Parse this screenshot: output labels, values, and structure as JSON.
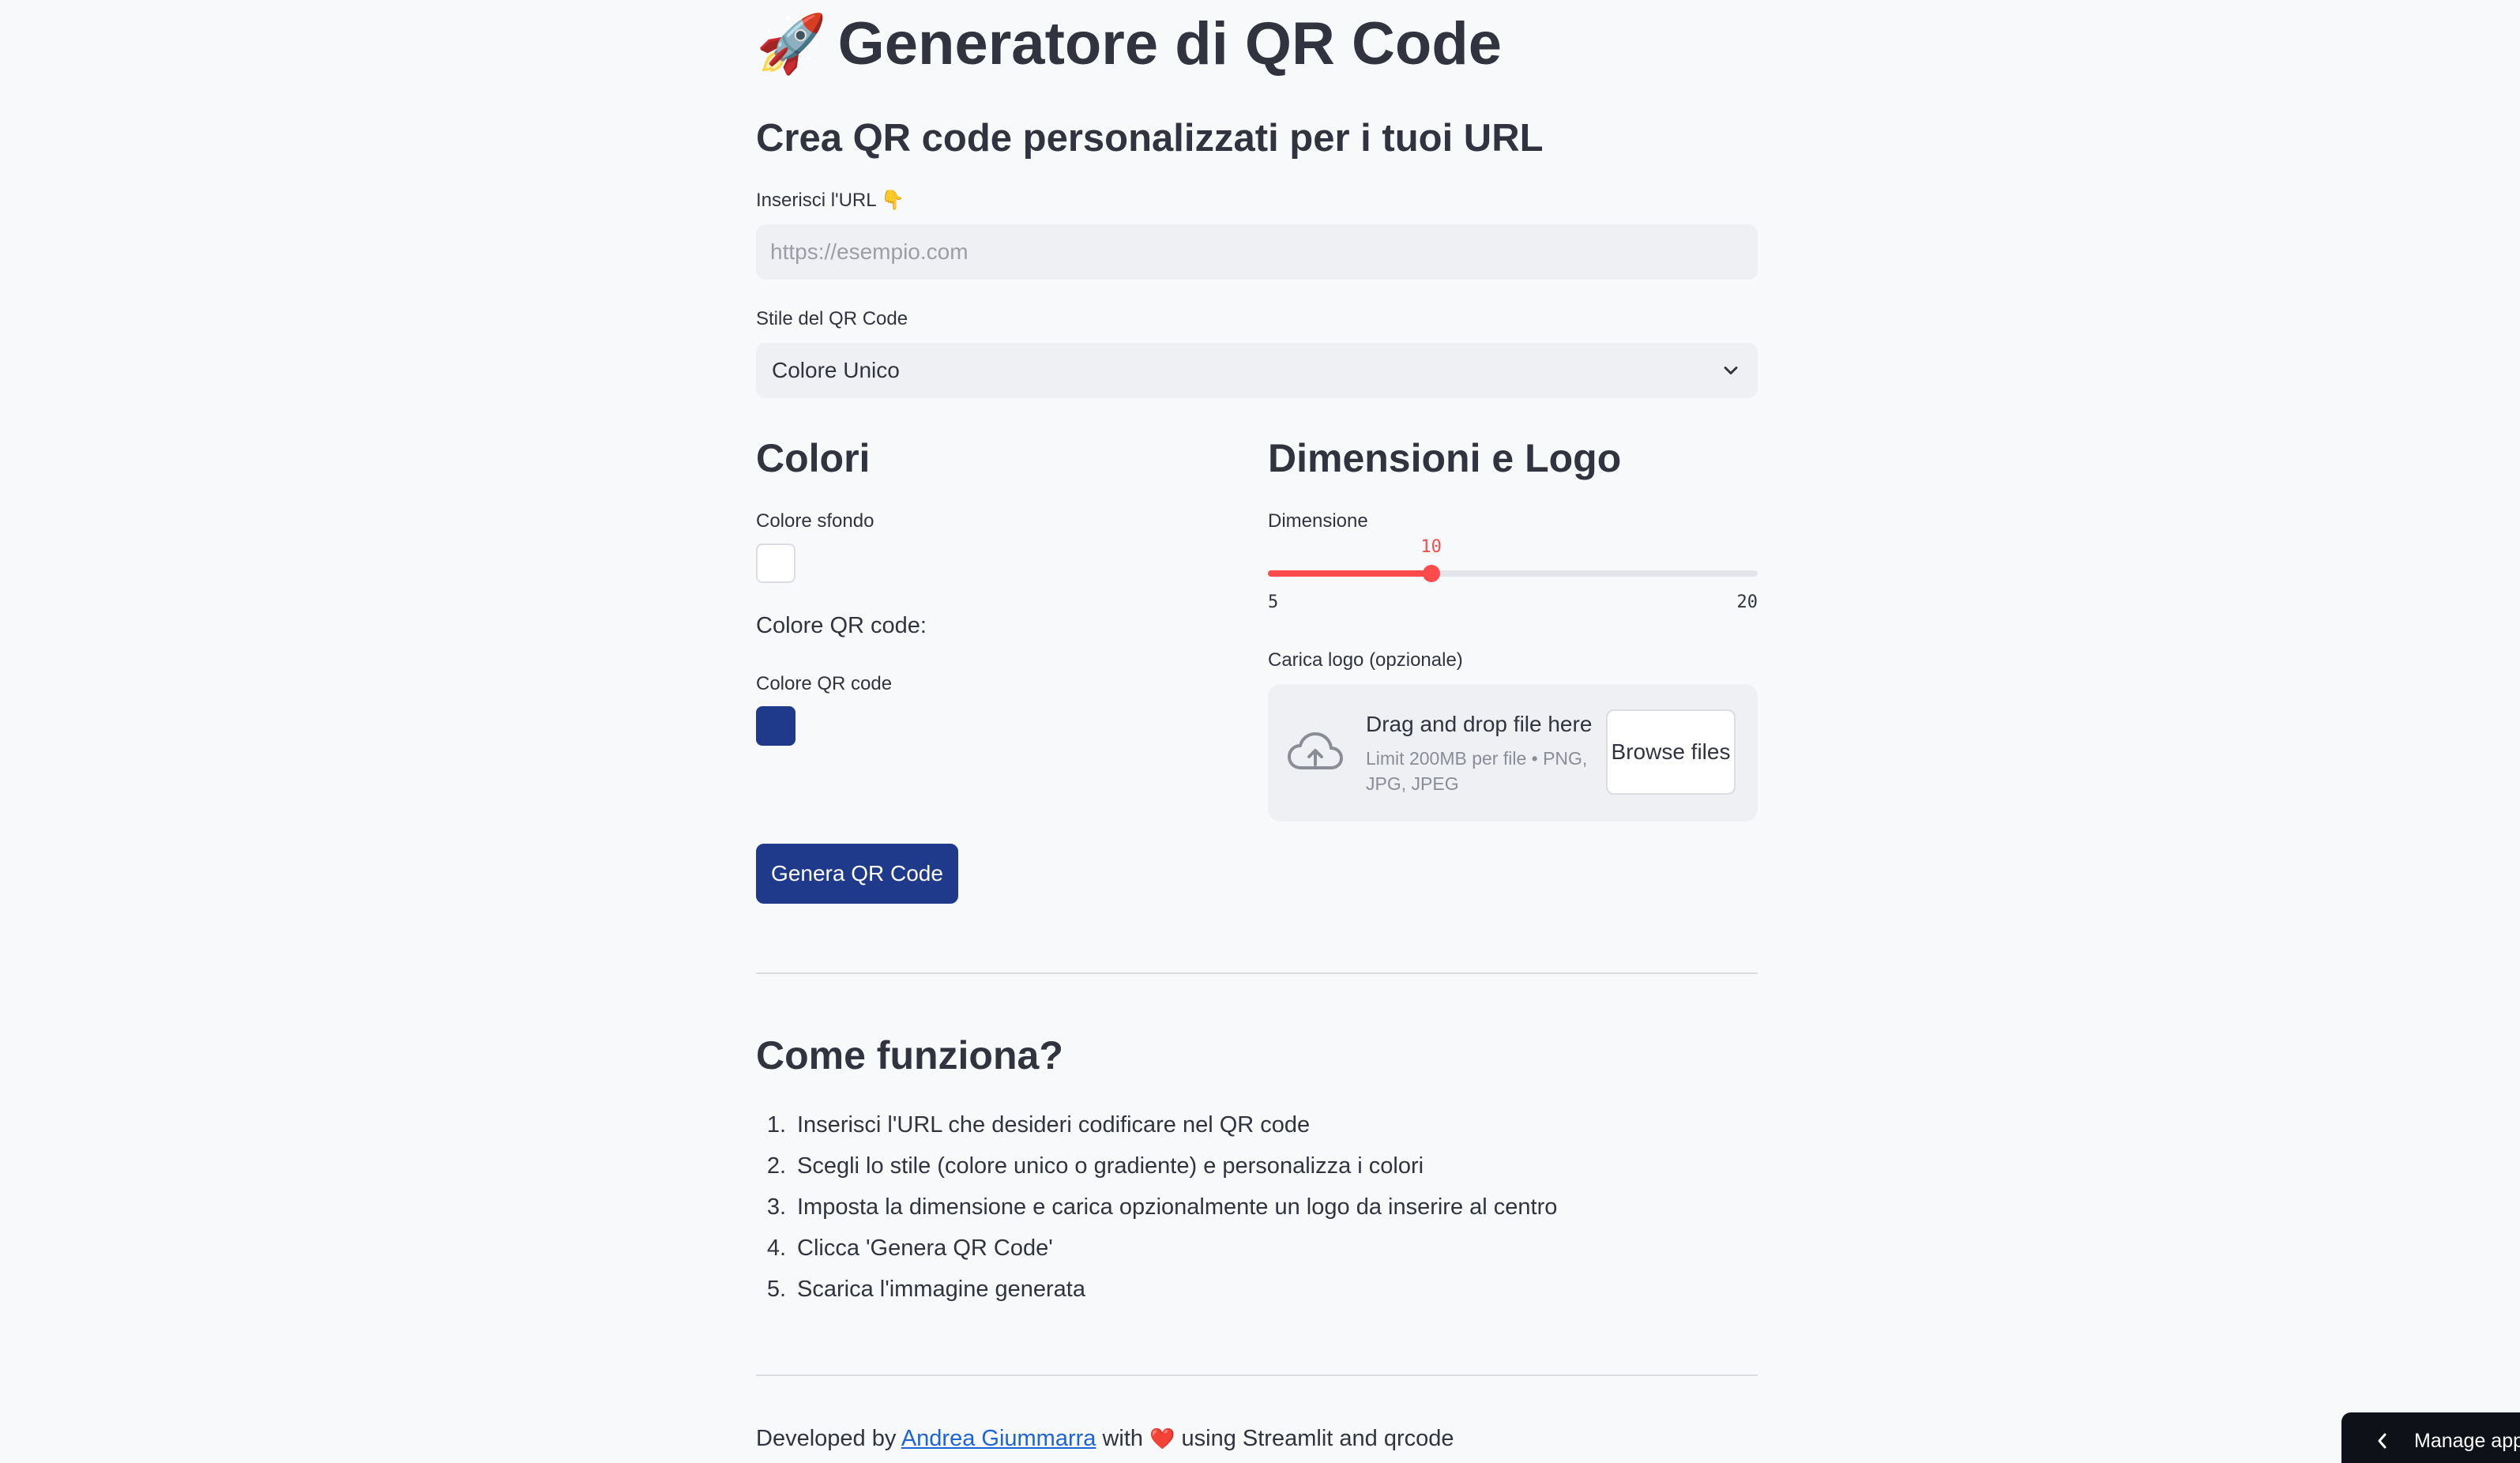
{
  "header": {
    "title_icon": "🚀",
    "title": "Generatore di QR Code",
    "subtitle": "Crea QR code personalizzati per i tuoi URL"
  },
  "url_input": {
    "label": "Inserisci l'URL 👇",
    "placeholder": "https://esempio.com",
    "value": ""
  },
  "style_select": {
    "label": "Stile del QR Code",
    "selected": "Colore Unico",
    "icon": "chevron-down-icon"
  },
  "colors_section": {
    "heading": "Colori",
    "background_label": "Colore sfondo",
    "background_color": "#ffffff",
    "qr_caption": "Colore QR code:",
    "qr_label": "Colore QR code",
    "qr_color": "#1f3a8a"
  },
  "size_logo_section": {
    "heading": "Dimensioni e Logo",
    "slider": {
      "label": "Dimensione",
      "value": 10,
      "min": 5,
      "max": 20,
      "value_text": "10",
      "min_text": "5",
      "max_text": "20",
      "accent": "#ff4b4b"
    },
    "upload": {
      "label": "Carica logo (opzionale)",
      "drop_text": "Drag and drop file here",
      "limit_text": "Limit 200MB per file • PNG, JPG, JPEG",
      "browse_label": "Browse files",
      "icon": "cloud-upload-icon"
    }
  },
  "generate_button": {
    "label": "Genera QR Code",
    "color": "#1f3a8a"
  },
  "how_it_works": {
    "heading": "Come funziona?",
    "steps": [
      {
        "num": "1.",
        "text": "Inserisci l'URL che desideri codificare nel QR code"
      },
      {
        "num": "2.",
        "text": "Scegli lo stile (colore unico o gradiente) e personalizza i colori"
      },
      {
        "num": "3.",
        "text": "Imposta la dimensione e carica opzionalmente un logo da inserire al centro"
      },
      {
        "num": "4.",
        "text": "Clicca 'Genera QR Code'"
      },
      {
        "num": "5.",
        "text": "Scarica l'immagine generata"
      }
    ]
  },
  "footer": {
    "prefix": "Developed by ",
    "author": "Andrea Giummarra",
    "middle": " with ",
    "heart": "❤️",
    "suffix": " using Streamlit and qrcode"
  },
  "manage_app": {
    "label": "Manage app",
    "icon": "chevron-left-icon"
  }
}
